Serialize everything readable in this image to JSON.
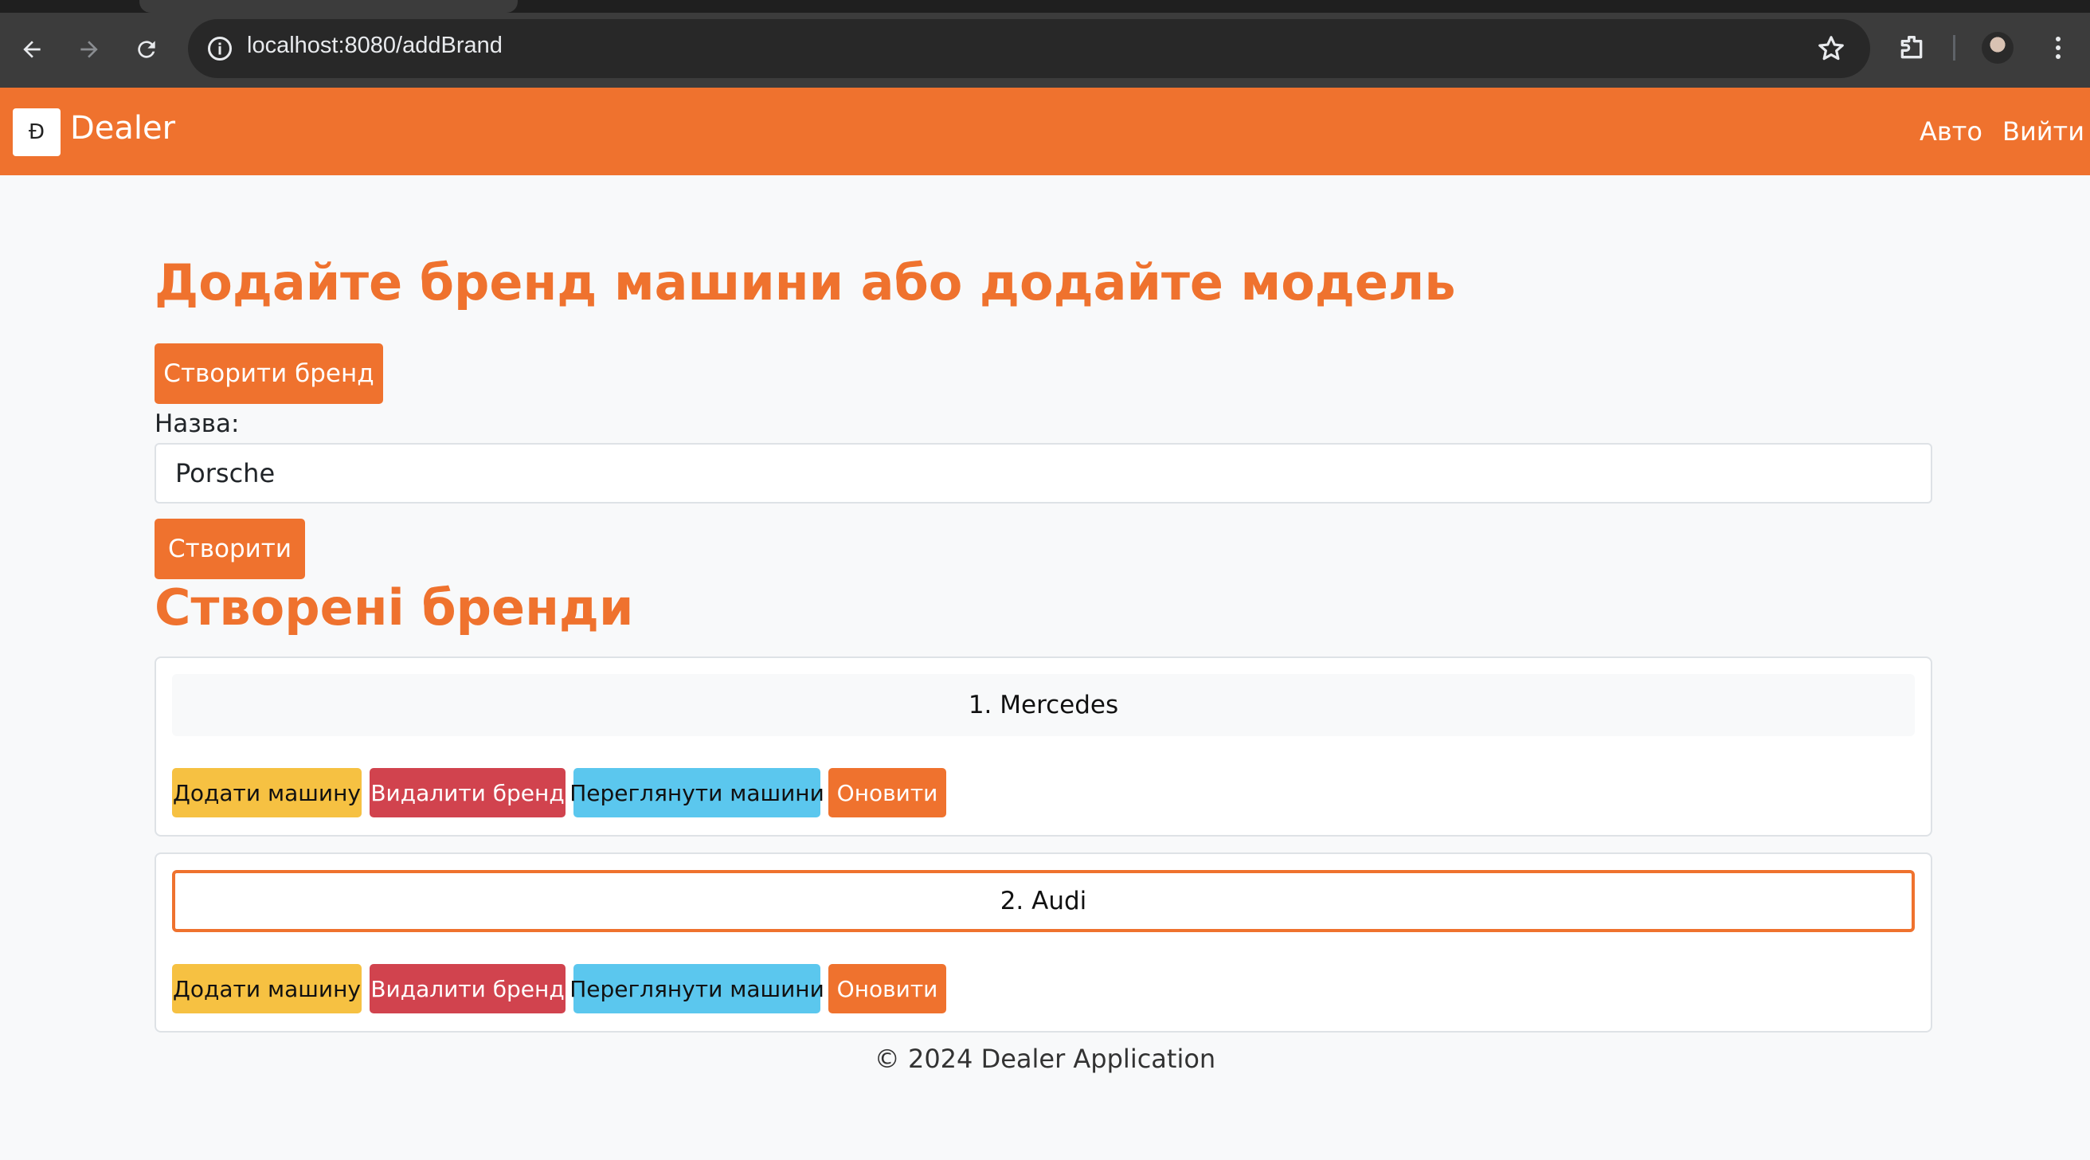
{
  "browser": {
    "url": "localhost:8080/addBrand",
    "icons": {
      "back": "arrow-left-icon",
      "forward": "arrow-right-icon",
      "reload": "reload-icon",
      "info": "info-icon",
      "bookmark": "star-icon",
      "extensions": "puzzle-icon",
      "menu": "kebab-menu-icon"
    }
  },
  "navbar": {
    "brand": "Dealer",
    "logo_glyph": "Ɖ",
    "links": [
      "Авто",
      "Вийти"
    ],
    "color": "#ef722e"
  },
  "page": {
    "title": "Додайте бренд машини або додайте модель",
    "create_brand_button": "Створити бренд",
    "name_label": "Назва:",
    "name_value": "Porsche",
    "submit_button": "Створити",
    "brands_title": "Створені бренди"
  },
  "brands": [
    {
      "label": "1. Mercedes",
      "actions": [
        "Додати машину",
        "Видалити бренд",
        "Переглянути машини",
        "Оновити"
      ]
    },
    {
      "label": "2. Audi",
      "actions": [
        "Додати машину",
        "Видалити бренд",
        "Переглянути машини",
        "Оновити"
      ]
    }
  ],
  "footer": "© 2024 Dealer Application",
  "colors": {
    "accent": "#ef722e",
    "warning": "#f6c142",
    "danger": "#d1434e",
    "info": "#5bc7ee"
  }
}
